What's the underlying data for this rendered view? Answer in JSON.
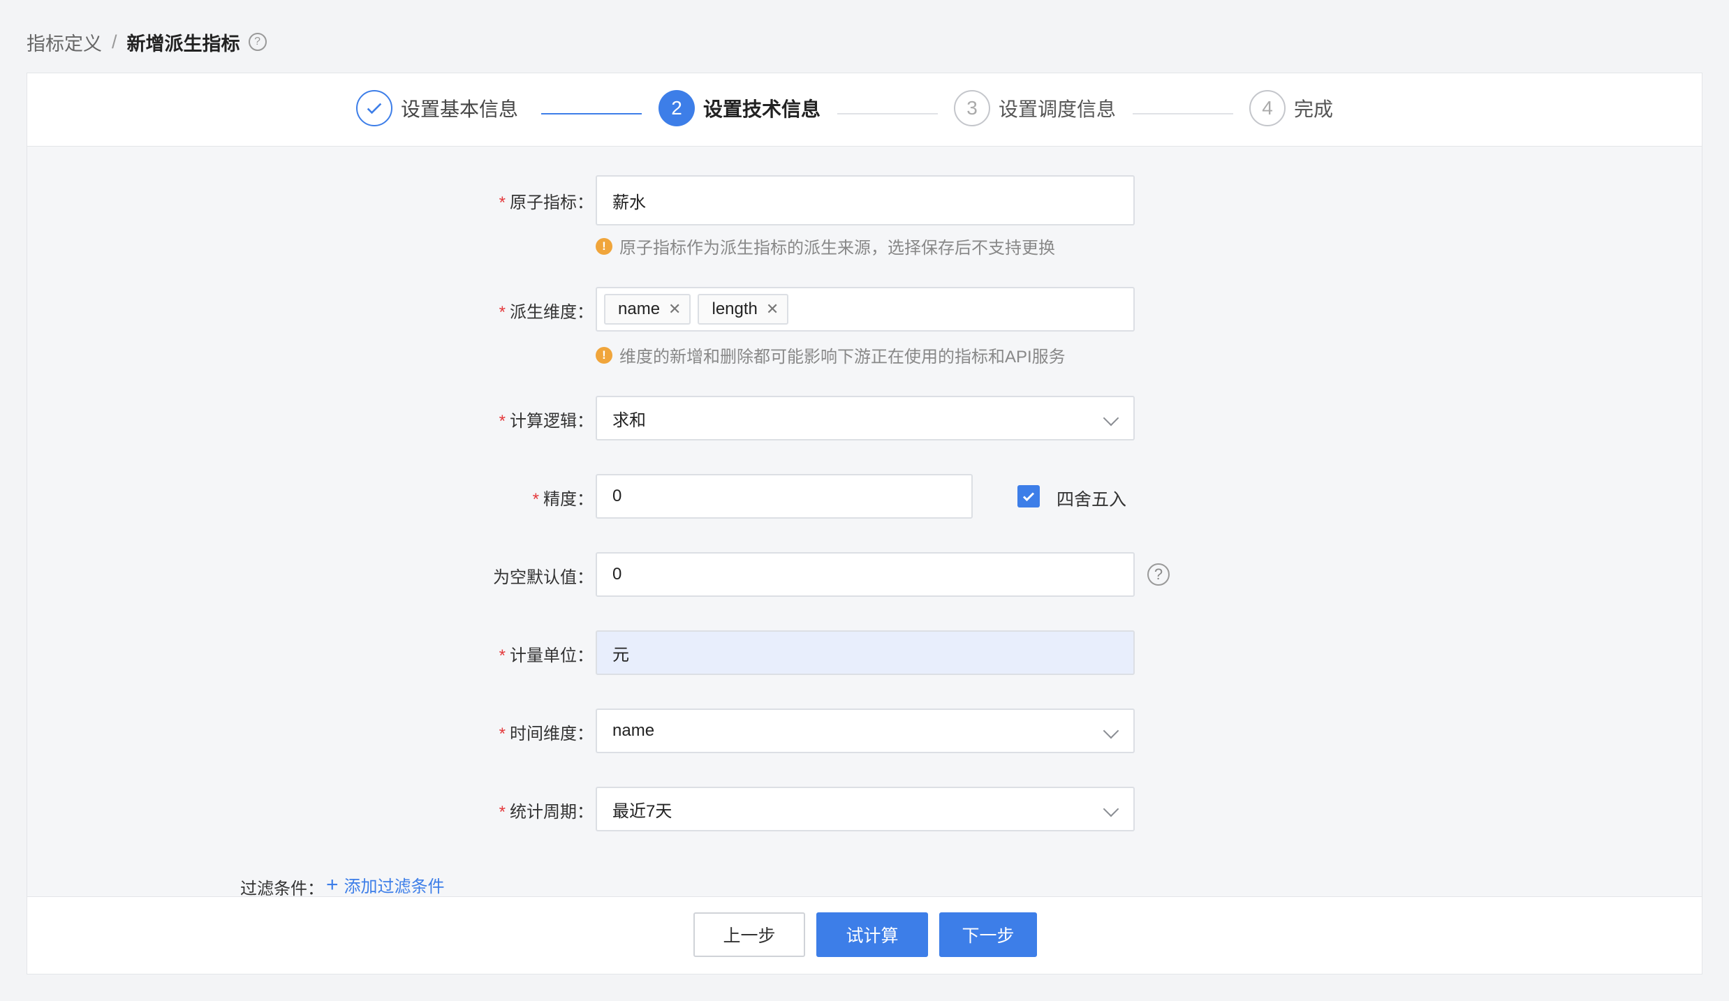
{
  "breadcrumb": {
    "parent": "指标定义",
    "separator": "/",
    "current": "新增派生指标",
    "help_icon": "question-circle-icon"
  },
  "steps": [
    {
      "number": "1",
      "label": "设置基本信息",
      "status": "done"
    },
    {
      "number": "2",
      "label": "设置技术信息",
      "status": "active"
    },
    {
      "number": "3",
      "label": "设置调度信息",
      "status": "todo"
    },
    {
      "number": "4",
      "label": "完成",
      "status": "todo"
    }
  ],
  "form": {
    "atomic_metric": {
      "label": "原子指标：",
      "required": true,
      "value": "薪水",
      "hint": "原子指标作为派生指标的派生来源，选择保存后不支持更换"
    },
    "derived_dimension": {
      "label": "派生维度：",
      "required": true,
      "tags": [
        "name",
        "length"
      ],
      "hint": "维度的新增和删除都可能影响下游正在使用的指标和API服务"
    },
    "calc_logic": {
      "label": "计算逻辑：",
      "required": true,
      "value": "求和"
    },
    "precision": {
      "label": "精度：",
      "required": true,
      "value": "0",
      "rounding_label": "四舍五入",
      "rounding_checked": true
    },
    "null_default": {
      "label": "为空默认值：",
      "required": false,
      "value": "0"
    },
    "unit": {
      "label": "计量单位：",
      "required": true,
      "value": "元"
    },
    "time_dimension": {
      "label": "时间维度：",
      "required": true,
      "value": "name"
    },
    "stat_period": {
      "label": "统计周期：",
      "required": true,
      "value": "最近7天"
    },
    "filter": {
      "label": "过滤条件：",
      "add_label": "添加过滤条件"
    }
  },
  "footer": {
    "prev_label": "上一步",
    "trial_label": "试计算",
    "next_label": "下一步"
  },
  "colors": {
    "accent": "#3d7ee8",
    "required": "#e4393c",
    "warning": "#f0a53b"
  }
}
